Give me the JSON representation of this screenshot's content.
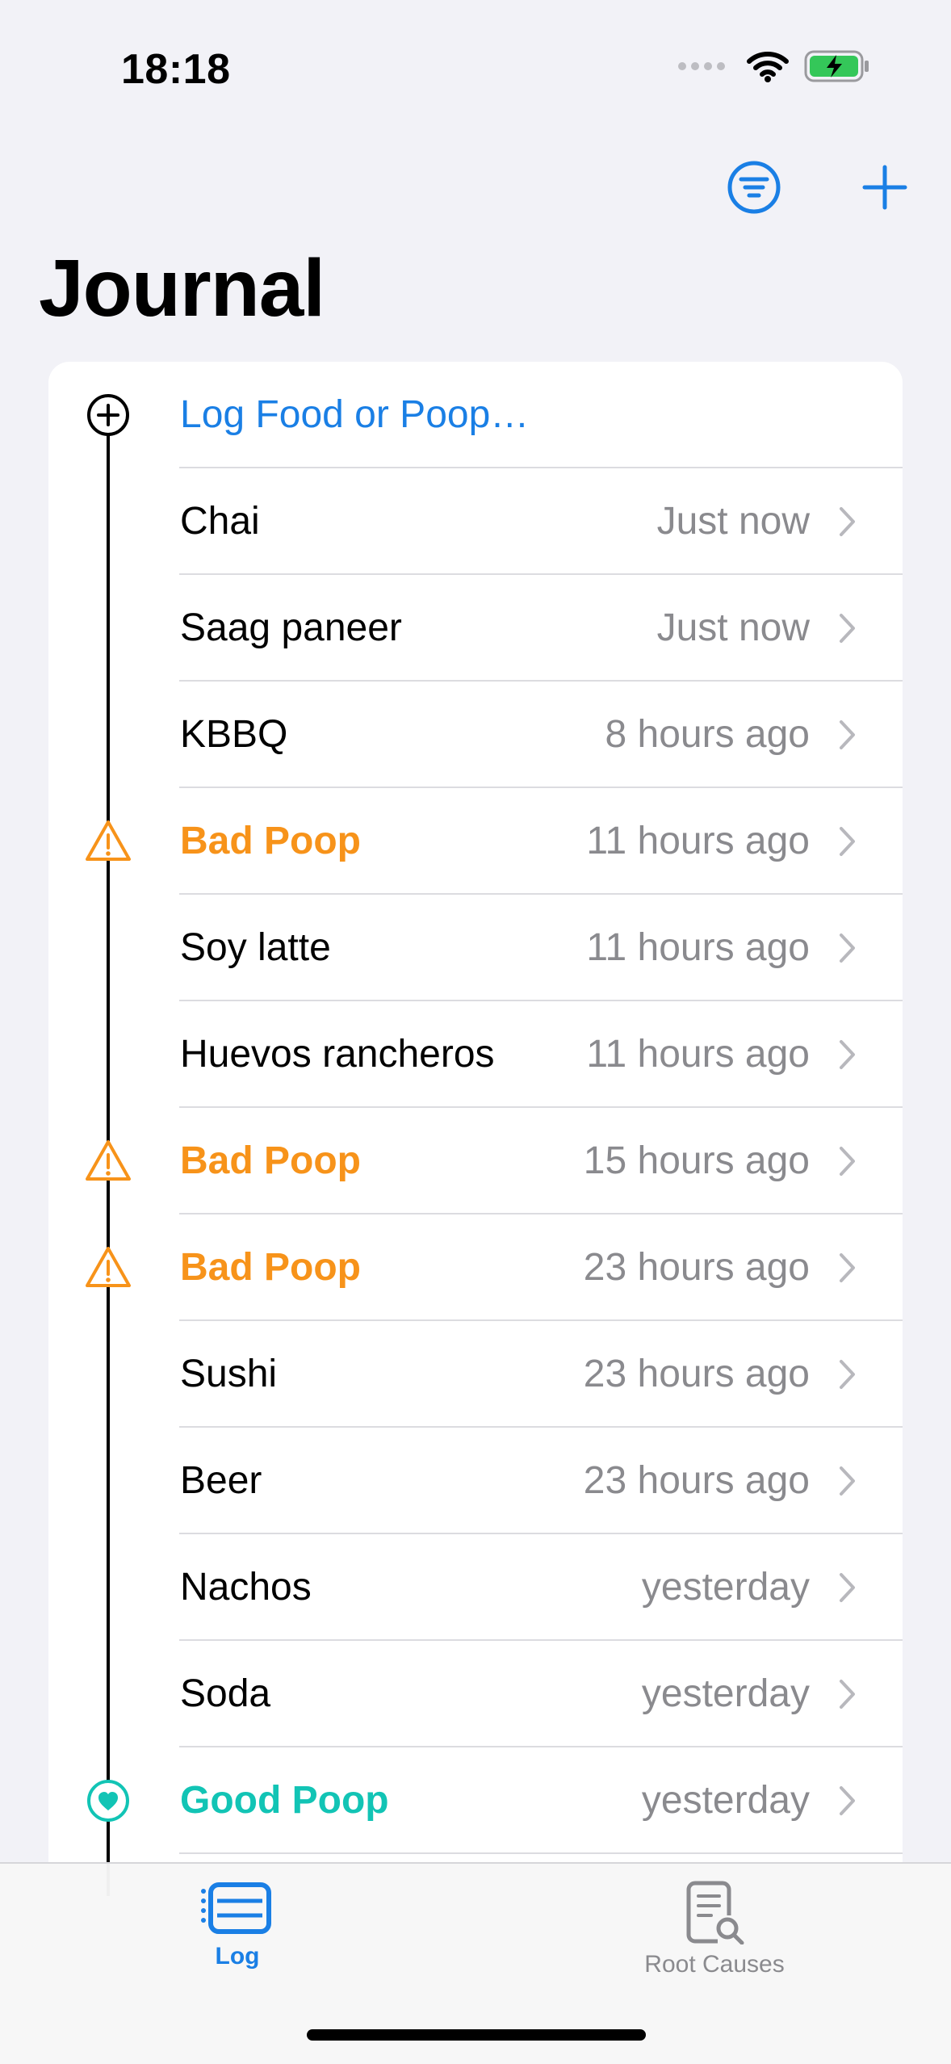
{
  "status": {
    "time": "18:18"
  },
  "nav": {
    "filter_icon": "line-3-horizontal-decrease-circle-icon",
    "add_icon": "plus-icon"
  },
  "page": {
    "title": "Journal"
  },
  "colors": {
    "accent": "#1A7FE5",
    "bad": "#F7931A",
    "good": "#12C4B5",
    "secondary_text": "#8A8A8E",
    "background": "#F2F2F7"
  },
  "log_action": {
    "label": "Log Food or Poop…",
    "icon": "plus-circle-icon"
  },
  "entries": [
    {
      "name": "Chai",
      "time": "Just now",
      "kind": "food"
    },
    {
      "name": "Saag paneer",
      "time": "Just now",
      "kind": "food"
    },
    {
      "name": "KBBQ",
      "time": "8 hours ago",
      "kind": "food"
    },
    {
      "name": "Bad Poop",
      "time": "11 hours ago",
      "kind": "bad"
    },
    {
      "name": "Soy latte",
      "time": "11 hours ago",
      "kind": "food"
    },
    {
      "name": "Huevos rancheros",
      "time": "11 hours ago",
      "kind": "food"
    },
    {
      "name": "Bad Poop",
      "time": "15 hours ago",
      "kind": "bad"
    },
    {
      "name": "Bad Poop",
      "time": "23 hours ago",
      "kind": "bad"
    },
    {
      "name": "Sushi",
      "time": "23 hours ago",
      "kind": "food"
    },
    {
      "name": "Beer",
      "time": "23 hours ago",
      "kind": "food"
    },
    {
      "name": "Nachos",
      "time": "yesterday",
      "kind": "food"
    },
    {
      "name": "Soda",
      "time": "yesterday",
      "kind": "food"
    },
    {
      "name": "Good Poop",
      "time": "yesterday",
      "kind": "good"
    }
  ],
  "tabs": [
    {
      "label": "Log",
      "icon": "list-bullet-rectangle-icon",
      "active": true
    },
    {
      "label": "Root Causes",
      "icon": "doc-magnifyingglass-icon",
      "active": false
    }
  ]
}
